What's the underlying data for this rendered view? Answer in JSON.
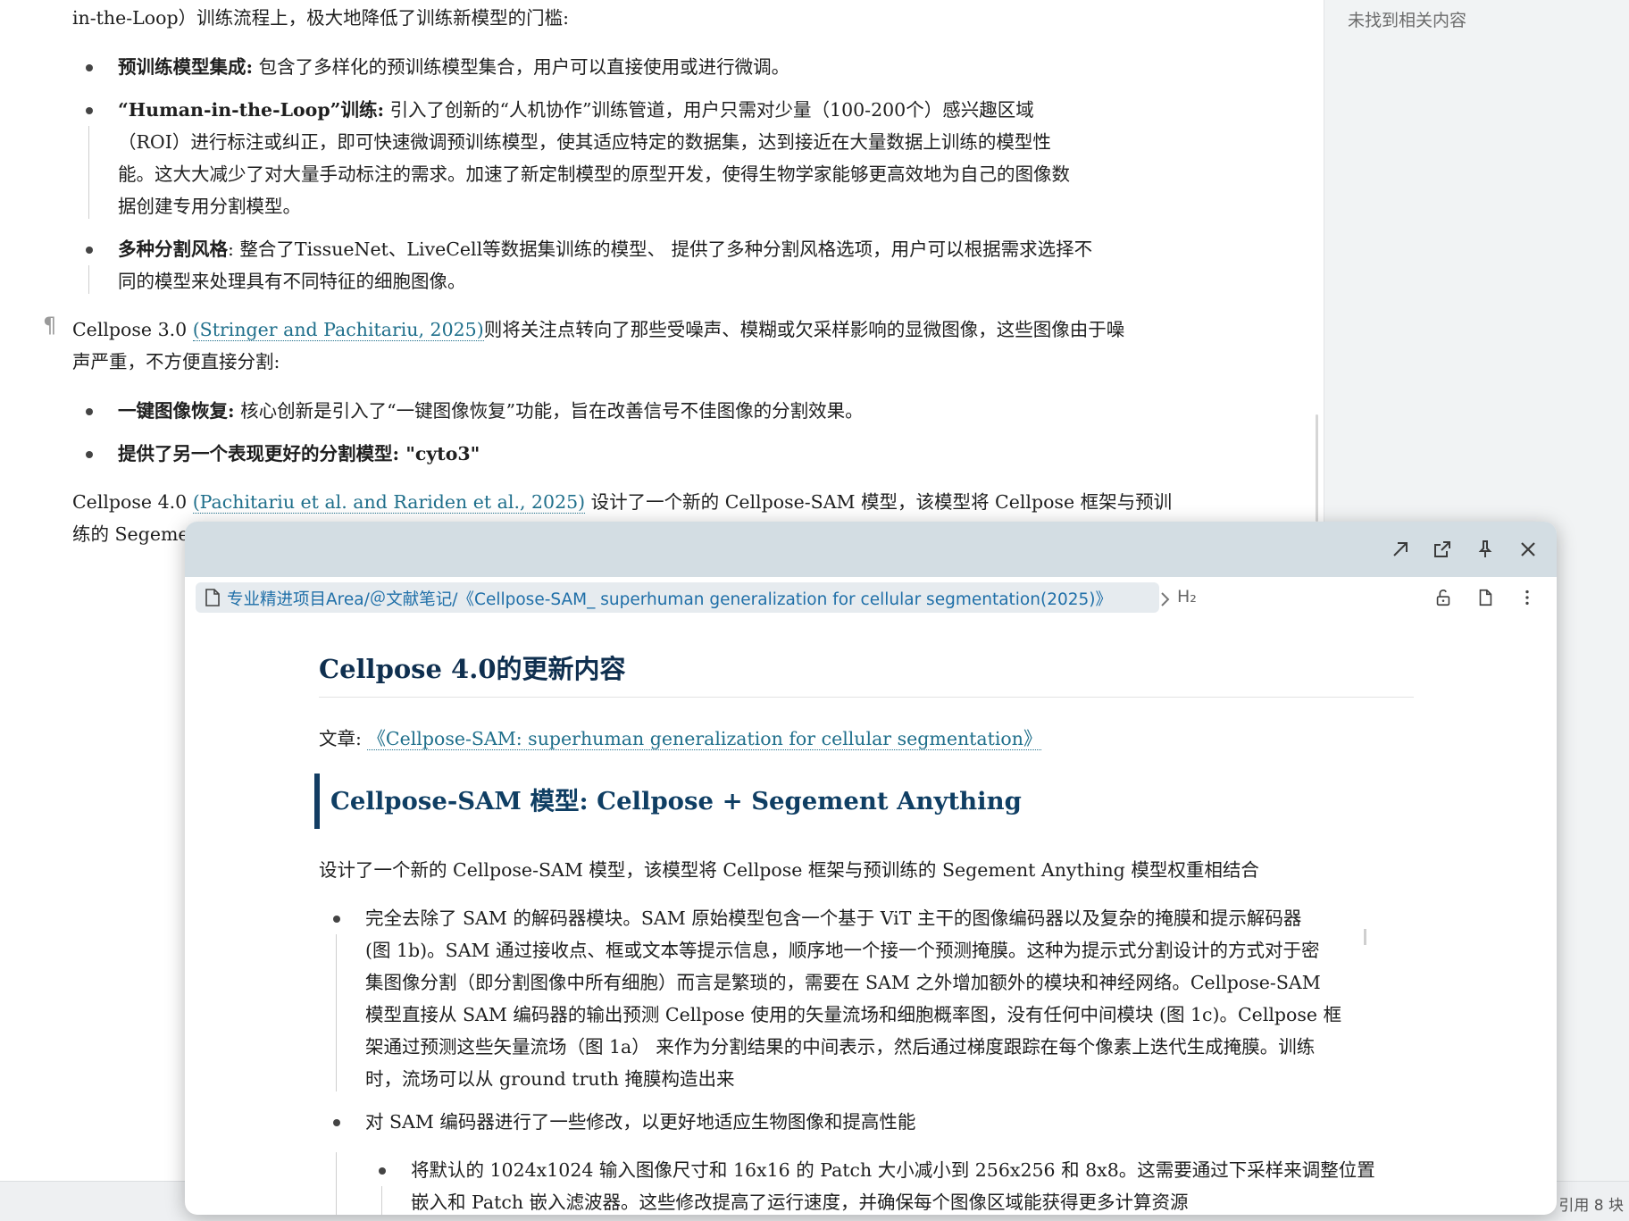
{
  "document": {
    "line_top": "in-the-Loop）训练流程上，极大地降低了训练新模型的门槛:",
    "bullets_v2": [
      {
        "bold": "预训练模型集成:",
        "text": "包含了多样化的预训练模型集合，用户可以直接使用或进行微调。"
      },
      {
        "bold": "“Human-in-the-Loop”训练:",
        "text": "引入了创新的“人机协作”训练管道，用户只需对少量（100-200个）感兴趣区域",
        "cont": [
          "（ROI）进行标注或纠正，即可快速微调预训练模型，使其适应特定的数据集，达到接近在大量数据上训练的模型性",
          "能。这大大减少了对大量手动标注的需求。加速了新定制模型的原型开发，使得生物学家能够更高效地为自己的图像数",
          "据创建专用分割模型。"
        ]
      },
      {
        "bold": "多种分割风格",
        "text": ": 整合了TissueNet、LiveCell等数据集训练的模型、 提供了多种分割风格选项，用户可以根据需求选择不",
        "cont": [
          "同的模型来处理具有不同特征的细胞图像。"
        ]
      }
    ],
    "pilcrow": "¶",
    "v3_para": {
      "pre": "Cellpose 3.0 ",
      "link": "(Stringer and Pachitariu, 2025)",
      "post": "则将关注点转向了那些受噪声、模糊或欠采样影响的显微图像，这些图像由于噪",
      "line2": "声严重，不方便直接分割:"
    },
    "bullets_v3": [
      {
        "bold": "一键图像恢复:",
        "text": "核心创新是引入了“一键图像恢复”功能，旨在改善信号不佳图像的分割效果。"
      },
      {
        "bold": "提供了另一个表现更好的分割模型: \"cyto3\"",
        "text": ""
      }
    ],
    "v4_para": {
      "pre": "Cellpose 4.0 ",
      "link": "(Pachitariu et al. and Rariden et al., 2025)",
      "post": " 设计了一个新的 Cellpose-SAM 模型，该模型将 Cellpose 框架与预训",
      "line2": "练的 Segeme"
    }
  },
  "sidebar": {
    "empty_text": "未找到相关内容"
  },
  "statusbar": {
    "refs": "引用 8  块"
  },
  "popup": {
    "breadcrumb": "专业精进项目Area/＠文献笔记/《Cellpose-SAM_ superhuman generalization for cellular segmentation(2025)》",
    "heading_level": "H₂",
    "h2": "Cellpose 4.0的更新内容",
    "meta_label": "文章: ",
    "meta_link": "《Cellpose-SAM: superhuman generalization for cellular segmentation》",
    "h3": "Cellpose-SAM 模型:  Cellpose + Segement Anything",
    "intro": "设计了一个新的 Cellpose-SAM 模型，该模型将 Cellpose 框架与预训练的 Segement Anything 模型权重相结合",
    "bullets": [
      {
        "lines": [
          "完全去除了 SAM 的解码器模块。SAM 原始模型包含一个基于 ViT 主干的图像编码器以及复杂的掩膜和提示解码器",
          "(图 1b)。SAM 通过接收点、框或文本等提示信息，顺序地一个接一个预测掩膜。这种为提示式分割设计的方式对于密",
          "集图像分割（即分割图像中所有细胞）而言是繁琐的，需要在 SAM 之外增加额外的模块和神经网络。Cellpose-SAM",
          "模型直接从 SAM 编码器的输出预测 Cellpose 使用的矢量流场和细胞概率图，没有任何中间模块 (图 1c)。Cellpose 框",
          "架通过预测这些矢量流场（图 1a） 来作为分割结果的中间表示，然后通过梯度跟踪在每个像素上迭代生成掩膜。训练",
          "时，流场可以从 ground truth 掩膜构造出来"
        ]
      },
      {
        "lines": [
          "对 SAM 编码器进行了一些修改，以更好地适应生物图像和提高性能"
        ]
      }
    ],
    "subbullet": {
      "lines": [
        "将默认的 1024x1024 输入图像尺寸和 16x16 的 Patch 大小减小到 256x256 和 8x8。这需要通过下采样来调整位置",
        "嵌入和 Patch 嵌入滤波器。这些修改提高了运行速度，并确保每个图像区域能获得更多计算资源"
      ]
    }
  }
}
